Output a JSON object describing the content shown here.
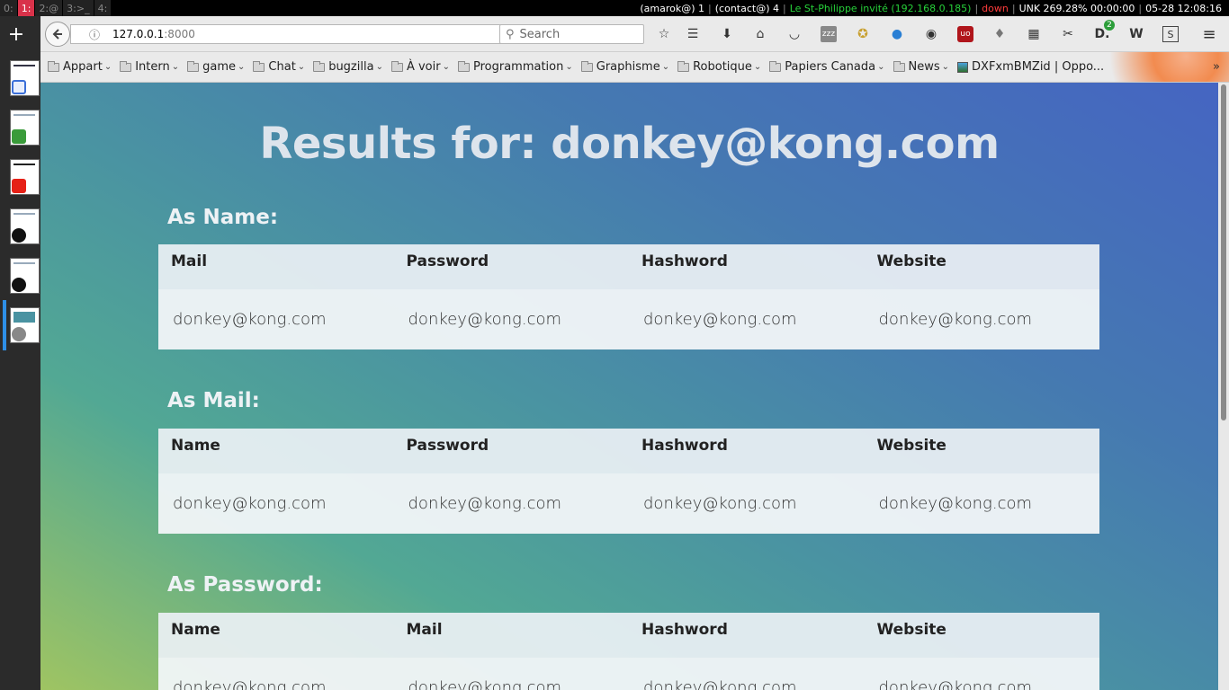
{
  "topbar": {
    "workspaces": [
      "0:",
      "1:",
      "2:@",
      "3:>_",
      "4:"
    ],
    "active_workspace": "1:",
    "status": {
      "amarok": "(amarok@) 1",
      "contact": "(contact@) 4",
      "wifi": "Le St-Philippe invité (192.168.0.185)",
      "eth": "down",
      "battery": "UNK 269.28% 00:00:00",
      "clock": "05-28 12:08:16"
    }
  },
  "sidebar": {
    "newtab_label": "+"
  },
  "toolbar": {
    "url_host": "127.0.0.1",
    "url_port": ":8000",
    "search_placeholder": "Search",
    "icons": [
      "star-icon",
      "reading-list-icon",
      "download-icon",
      "home-icon",
      "pocket-icon",
      "zzz-icon",
      "medal-icon",
      "drop-icon",
      "robot-icon",
      "ublock-icon",
      "bell-icon",
      "grid-icon",
      "screenshot-icon",
      "d-icon",
      "w-icon",
      "s-icon",
      "menu-icon"
    ],
    "badge_count": "2"
  },
  "bookmarks": {
    "items": [
      "Appart",
      "Intern",
      "game",
      "Chat",
      "bugzilla",
      "À voir",
      "Programmation",
      "Graphisme",
      "Robotique",
      "Papiers Canada",
      "News"
    ],
    "last_item": "DXFxmBMZid | Oppo...",
    "more": "»"
  },
  "page": {
    "title": "Results for: donkey@kong.com",
    "sections": [
      {
        "heading": "As Name:",
        "columns": [
          "Mail",
          "Password",
          "Hashword",
          "Website"
        ],
        "row": [
          "donkey@kong.com",
          "donkey@kong.com",
          "donkey@kong.com",
          "donkey@kong.com"
        ]
      },
      {
        "heading": "As Mail:",
        "columns": [
          "Name",
          "Password",
          "Hashword",
          "Website"
        ],
        "row": [
          "donkey@kong.com",
          "donkey@kong.com",
          "donkey@kong.com",
          "donkey@kong.com"
        ]
      },
      {
        "heading": "As Password:",
        "columns": [
          "Name",
          "Mail",
          "Hashword",
          "Website"
        ],
        "row": [
          "donkey@kong.com",
          "donkey@kong.com",
          "donkey@kong.com",
          "donkey@kong.com"
        ]
      }
    ]
  }
}
